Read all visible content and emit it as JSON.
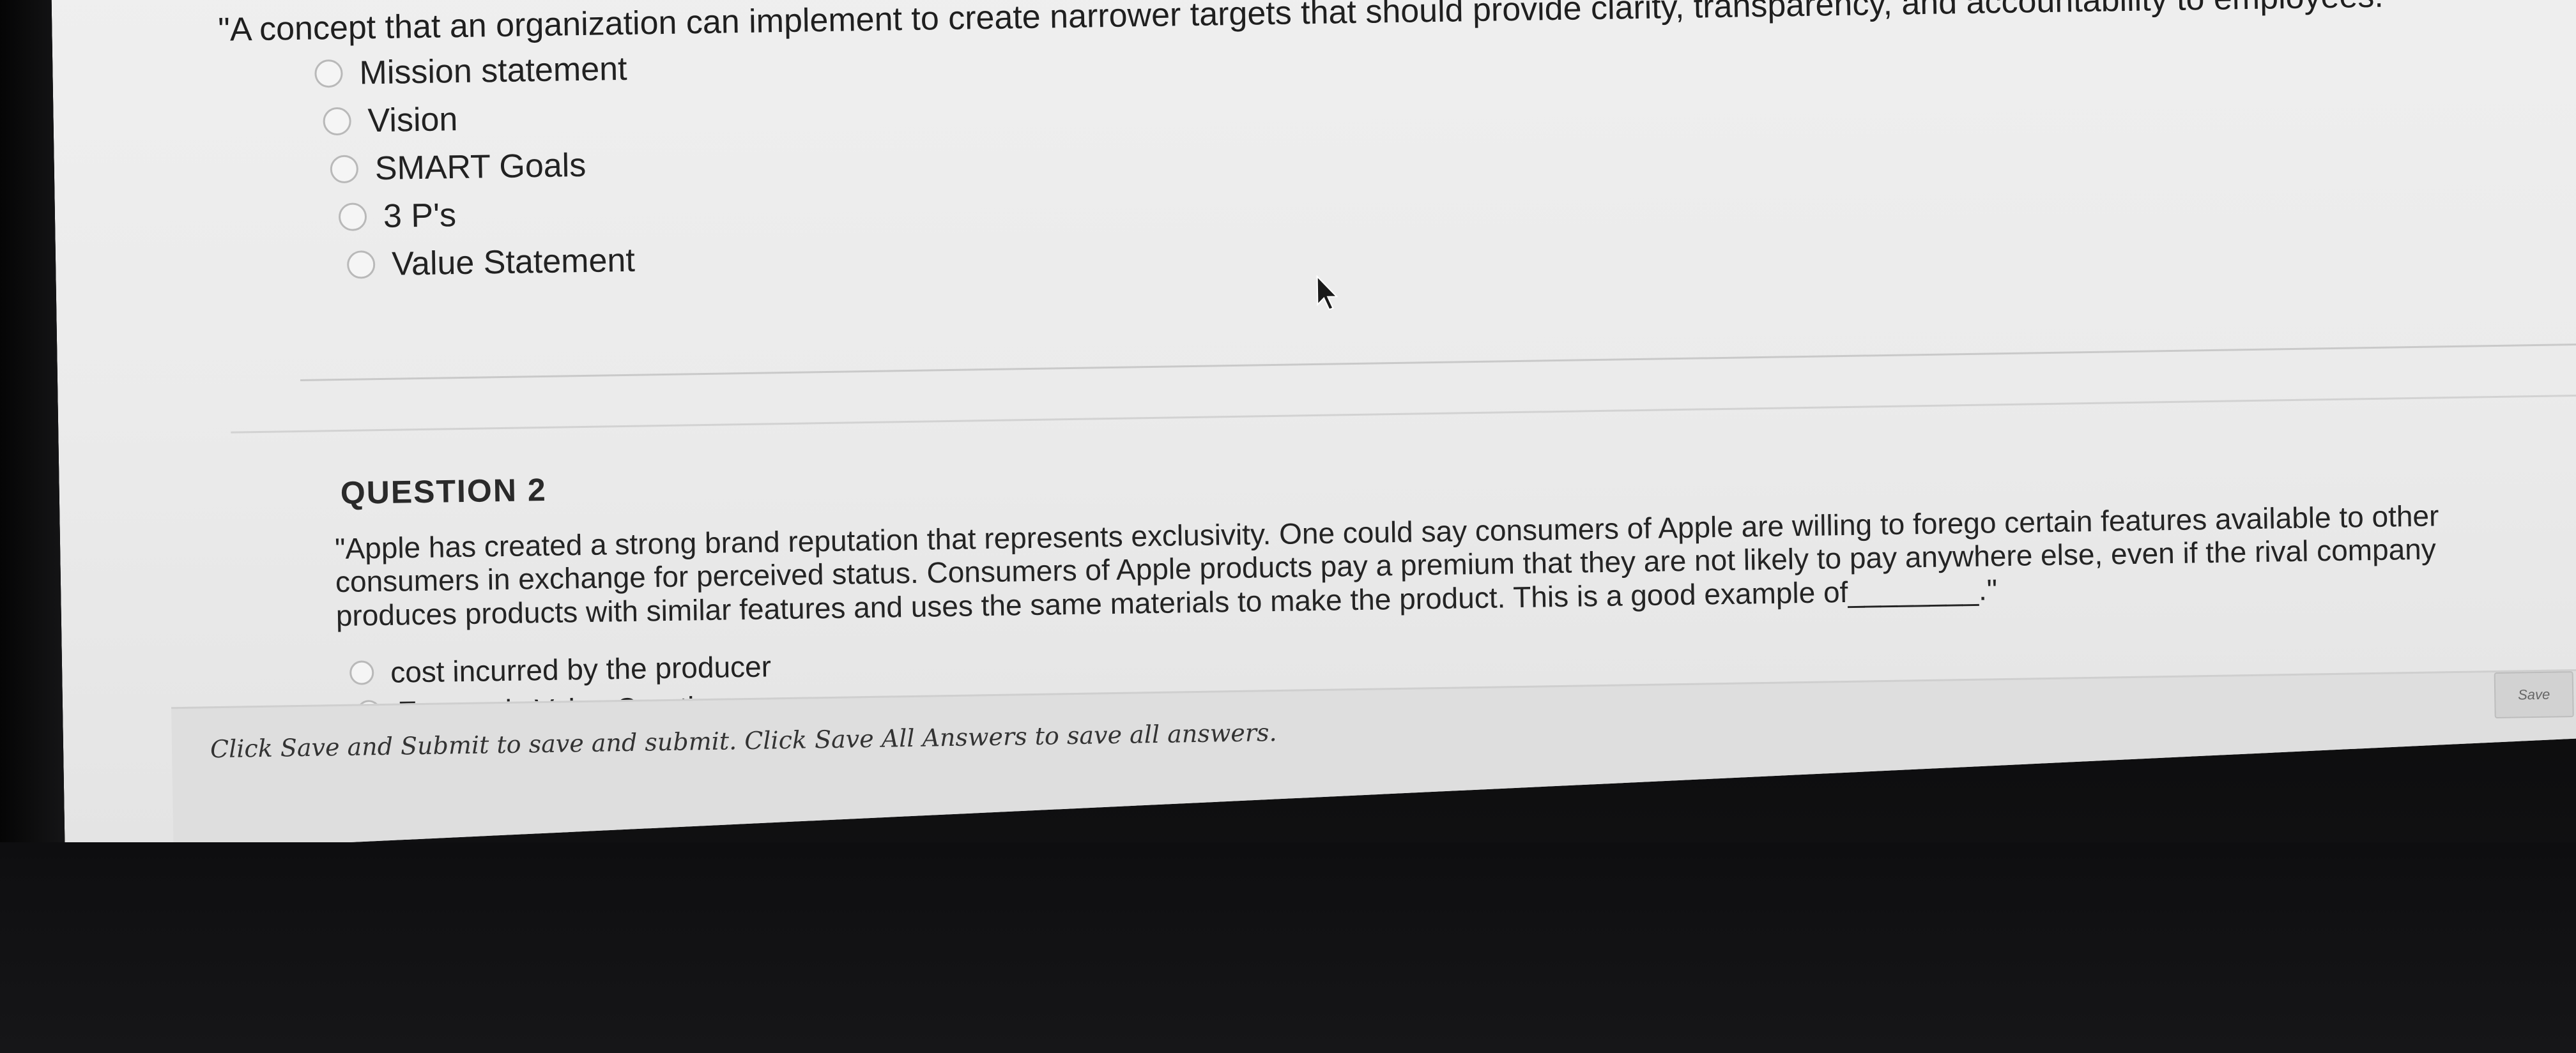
{
  "question1": {
    "text": "\"A concept that an organization can implement to create narrower targets that should provide clarity, transparency, and accountability to employees.\"",
    "options": [
      {
        "label": "Mission statement"
      },
      {
        "label": "Vision"
      },
      {
        "label": "SMART Goals"
      },
      {
        "label": "3 P's"
      },
      {
        "label": "Value Statement"
      }
    ]
  },
  "question2": {
    "heading": "QUESTION 2",
    "text": "\"Apple has created a strong brand reputation that represents exclusivity. One could say consumers of Apple are willing to forego certain features available to other consumers in exchange for perceived status. Consumers of Apple products pay a premium that they are not likely to pay anywhere else, even if the rival company produces products with similar features and uses the same materials to make the product. This is a good example of________.\"",
    "options": [
      {
        "label": "cost incurred by the producer"
      },
      {
        "label": "Economic Value Creation"
      }
    ]
  },
  "footer": {
    "instructions": "Click Save and Submit to save and submit. Click Save All Answers to save all answers.",
    "save_label": "Save"
  },
  "colors": {
    "screen_bg": "#ececec",
    "text": "#1f1f1f",
    "footer_bg": "#dedede"
  }
}
